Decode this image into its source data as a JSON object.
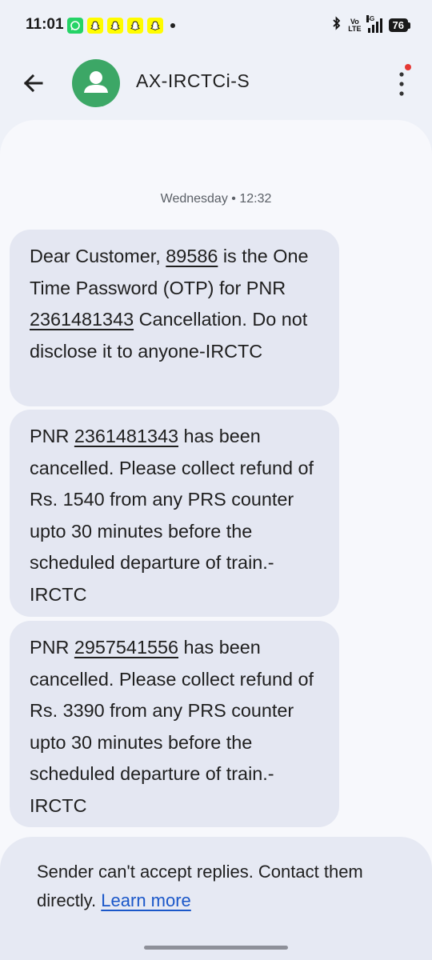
{
  "status_bar": {
    "time": "11:01",
    "notifications": [
      "whatsapp-icon",
      "snapchat-icon",
      "snapchat-icon",
      "snapchat-icon",
      "snapchat-icon"
    ],
    "volte_line1": "Vo",
    "volte_line2": "LTE",
    "network": "5G",
    "battery": "76"
  },
  "header": {
    "contact_name": "AX-IRCTCi-S"
  },
  "conversation": {
    "date_separator": "Wednesday • 12:32",
    "messages": [
      {
        "p1": "Dear Customer, ",
        "otp": "89586",
        "p2": " is the One Time Password (OTP) for PNR ",
        "pnr": "2361481343",
        "p3": " Cancellation. Do not disclose it to anyone-IRCTC"
      },
      {
        "p1": "PNR ",
        "pnr": "2361481343",
        "p2": " has been cancelled.  Please collect refund of Rs. 1540 from any PRS counter upto 30 minutes before the scheduled departure of train.-IRCTC"
      },
      {
        "p1": "PNR ",
        "pnr": "2957541556",
        "p2": " has been cancelled.  Please collect refund of Rs. 3390 from any PRS counter upto 30 minutes before the scheduled departure of train.-IRCTC"
      }
    ]
  },
  "footer": {
    "notice": "Sender can't accept replies. Contact them directly. ",
    "learn_more": "Learn more"
  },
  "colors": {
    "avatar": "#3ca766",
    "bubble": "#e4e7f2",
    "link": "#1a57c9",
    "badge": "#e53935"
  }
}
